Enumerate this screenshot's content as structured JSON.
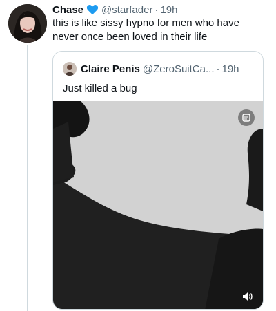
{
  "tweet": {
    "author_name": "Chase",
    "handle": "@starfader",
    "separator": "·",
    "time": "19h",
    "text": "this is like sissy hypno for men who have never once been loved in their life",
    "heart_color": "#1d9bf0"
  },
  "quoted_tweet": {
    "author_name": "Claire Penis",
    "handle": "@ZeroSuitCa...",
    "separator": "·",
    "time": "19h",
    "text": "Just killed a bug"
  },
  "media": {
    "type": "video",
    "icons": [
      "gif-pause-icon",
      "speaker-icon"
    ]
  }
}
